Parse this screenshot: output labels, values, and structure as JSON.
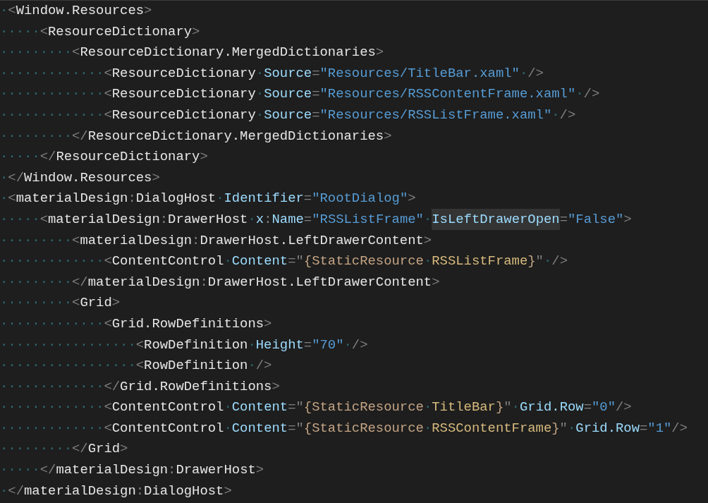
{
  "editor": {
    "lines": [
      {
        "tokens": [
          {
            "kind": "space",
            "text": "·"
          },
          {
            "kind": "punct",
            "text": "<"
          },
          {
            "kind": "tag",
            "text": "Window.Resources"
          },
          {
            "kind": "punct",
            "text": ">"
          }
        ]
      },
      {
        "tokens": [
          {
            "kind": "space",
            "text": "·····"
          },
          {
            "kind": "punct",
            "text": "<"
          },
          {
            "kind": "tag",
            "text": "ResourceDictionary"
          },
          {
            "kind": "punct",
            "text": ">"
          }
        ]
      },
      {
        "tokens": [
          {
            "kind": "space",
            "text": "·········"
          },
          {
            "kind": "punct",
            "text": "<"
          },
          {
            "kind": "tag",
            "text": "ResourceDictionary.MergedDictionaries"
          },
          {
            "kind": "punct",
            "text": ">"
          }
        ]
      },
      {
        "tokens": [
          {
            "kind": "space",
            "text": "·············"
          },
          {
            "kind": "punct",
            "text": "<"
          },
          {
            "kind": "tag",
            "text": "ResourceDictionary"
          },
          {
            "kind": "space",
            "text": "·"
          },
          {
            "kind": "attr",
            "text": "Source"
          },
          {
            "kind": "punct",
            "text": "="
          },
          {
            "kind": "string",
            "text": "\"Resources/TitleBar.xaml\""
          },
          {
            "kind": "space",
            "text": "·"
          },
          {
            "kind": "punct",
            "text": "/>"
          }
        ]
      },
      {
        "tokens": [
          {
            "kind": "space",
            "text": "·············"
          },
          {
            "kind": "punct",
            "text": "<"
          },
          {
            "kind": "tag",
            "text": "ResourceDictionary"
          },
          {
            "kind": "space",
            "text": "·"
          },
          {
            "kind": "attr",
            "text": "Source"
          },
          {
            "kind": "punct",
            "text": "="
          },
          {
            "kind": "string",
            "text": "\"Resources/RSSContentFrame.xaml\""
          },
          {
            "kind": "space",
            "text": "·"
          },
          {
            "kind": "punct",
            "text": "/>"
          }
        ]
      },
      {
        "tokens": [
          {
            "kind": "space",
            "text": "·············"
          },
          {
            "kind": "punct",
            "text": "<"
          },
          {
            "kind": "tag",
            "text": "ResourceDictionary"
          },
          {
            "kind": "space",
            "text": "·"
          },
          {
            "kind": "attr",
            "text": "Source"
          },
          {
            "kind": "punct",
            "text": "="
          },
          {
            "kind": "string",
            "text": "\"Resources/RSSListFrame.xaml\""
          },
          {
            "kind": "space",
            "text": "·"
          },
          {
            "kind": "punct",
            "text": "/>"
          }
        ]
      },
      {
        "tokens": [
          {
            "kind": "space",
            "text": "·········"
          },
          {
            "kind": "punct",
            "text": "</"
          },
          {
            "kind": "tag",
            "text": "ResourceDictionary.MergedDictionaries"
          },
          {
            "kind": "punct",
            "text": ">"
          }
        ]
      },
      {
        "tokens": [
          {
            "kind": "space",
            "text": "·····"
          },
          {
            "kind": "punct",
            "text": "</"
          },
          {
            "kind": "tag",
            "text": "ResourceDictionary"
          },
          {
            "kind": "punct",
            "text": ">"
          }
        ]
      },
      {
        "tokens": [
          {
            "kind": "space",
            "text": "·"
          },
          {
            "kind": "punct",
            "text": "</"
          },
          {
            "kind": "tag",
            "text": "Window.Resources"
          },
          {
            "kind": "punct",
            "text": ">"
          }
        ]
      },
      {
        "tokens": [
          {
            "kind": "space",
            "text": "·"
          },
          {
            "kind": "punct",
            "text": "<"
          },
          {
            "kind": "tag",
            "text": "materialDesign"
          },
          {
            "kind": "punct",
            "text": ":"
          },
          {
            "kind": "tag",
            "text": "DialogHost"
          },
          {
            "kind": "space",
            "text": "·"
          },
          {
            "kind": "attr",
            "text": "Identifier"
          },
          {
            "kind": "punct",
            "text": "="
          },
          {
            "kind": "string",
            "text": "\"RootDialog\""
          },
          {
            "kind": "punct",
            "text": ">"
          }
        ]
      },
      {
        "tokens": [
          {
            "kind": "space",
            "text": "·····"
          },
          {
            "kind": "punct",
            "text": "<"
          },
          {
            "kind": "tag",
            "text": "materialDesign"
          },
          {
            "kind": "punct",
            "text": ":"
          },
          {
            "kind": "tag",
            "text": "DrawerHost"
          },
          {
            "kind": "space",
            "text": "·"
          },
          {
            "kind": "attr",
            "text": "x"
          },
          {
            "kind": "punct",
            "text": ":"
          },
          {
            "kind": "attr",
            "text": "Name"
          },
          {
            "kind": "punct",
            "text": "="
          },
          {
            "kind": "string",
            "text": "\"RSSListFrame\""
          },
          {
            "kind": "space",
            "text": "·"
          },
          {
            "kind": "attr",
            "text": "IsLeftDrawerOpen",
            "highlighted": true
          },
          {
            "kind": "punct",
            "text": "="
          },
          {
            "kind": "string",
            "text": "\"False\""
          },
          {
            "kind": "punct",
            "text": ">"
          }
        ]
      },
      {
        "tokens": [
          {
            "kind": "space",
            "text": "·········"
          },
          {
            "kind": "punct",
            "text": "<"
          },
          {
            "kind": "tag",
            "text": "materialDesign"
          },
          {
            "kind": "punct",
            "text": ":"
          },
          {
            "kind": "tag",
            "text": "DrawerHost.LeftDrawerContent"
          },
          {
            "kind": "punct",
            "text": ">"
          }
        ]
      },
      {
        "tokens": [
          {
            "kind": "space",
            "text": "·············"
          },
          {
            "kind": "punct",
            "text": "<"
          },
          {
            "kind": "tag",
            "text": "ContentControl"
          },
          {
            "kind": "space",
            "text": "·"
          },
          {
            "kind": "attr",
            "text": "Content"
          },
          {
            "kind": "punct",
            "text": "=\""
          },
          {
            "kind": "markup",
            "text": "{StaticResource"
          },
          {
            "kind": "space",
            "text": "·"
          },
          {
            "kind": "resource",
            "text": "RSSListFrame"
          },
          {
            "kind": "markup",
            "text": "}"
          },
          {
            "kind": "punct",
            "text": "\""
          },
          {
            "kind": "space",
            "text": "·"
          },
          {
            "kind": "punct",
            "text": "/>"
          }
        ]
      },
      {
        "tokens": [
          {
            "kind": "space",
            "text": "·········"
          },
          {
            "kind": "punct",
            "text": "</"
          },
          {
            "kind": "tag",
            "text": "materialDesign"
          },
          {
            "kind": "punct",
            "text": ":"
          },
          {
            "kind": "tag",
            "text": "DrawerHost.LeftDrawerContent"
          },
          {
            "kind": "punct",
            "text": ">"
          }
        ]
      },
      {
        "tokens": [
          {
            "kind": "space",
            "text": "·········"
          },
          {
            "kind": "punct",
            "text": "<"
          },
          {
            "kind": "tag",
            "text": "Grid"
          },
          {
            "kind": "punct",
            "text": ">"
          }
        ]
      },
      {
        "tokens": [
          {
            "kind": "space",
            "text": "·············"
          },
          {
            "kind": "punct",
            "text": "<"
          },
          {
            "kind": "tag",
            "text": "Grid.RowDefinitions"
          },
          {
            "kind": "punct",
            "text": ">"
          }
        ]
      },
      {
        "tokens": [
          {
            "kind": "space",
            "text": "·················"
          },
          {
            "kind": "punct",
            "text": "<"
          },
          {
            "kind": "tag",
            "text": "RowDefinition"
          },
          {
            "kind": "space",
            "text": "·"
          },
          {
            "kind": "attr",
            "text": "Height"
          },
          {
            "kind": "punct",
            "text": "="
          },
          {
            "kind": "string",
            "text": "\"70\""
          },
          {
            "kind": "space",
            "text": "·"
          },
          {
            "kind": "punct",
            "text": "/>"
          }
        ]
      },
      {
        "tokens": [
          {
            "kind": "space",
            "text": "·················"
          },
          {
            "kind": "punct",
            "text": "<"
          },
          {
            "kind": "tag",
            "text": "RowDefinition"
          },
          {
            "kind": "space",
            "text": "·"
          },
          {
            "kind": "punct",
            "text": "/>"
          }
        ]
      },
      {
        "tokens": [
          {
            "kind": "space",
            "text": "·············"
          },
          {
            "kind": "punct",
            "text": "</"
          },
          {
            "kind": "tag",
            "text": "Grid.RowDefinitions"
          },
          {
            "kind": "punct",
            "text": ">"
          }
        ]
      },
      {
        "tokens": [
          {
            "kind": "space",
            "text": "·············"
          },
          {
            "kind": "punct",
            "text": "<"
          },
          {
            "kind": "tag",
            "text": "ContentControl"
          },
          {
            "kind": "space",
            "text": "·"
          },
          {
            "kind": "attr",
            "text": "Content"
          },
          {
            "kind": "punct",
            "text": "=\""
          },
          {
            "kind": "markup",
            "text": "{StaticResource"
          },
          {
            "kind": "space",
            "text": "·"
          },
          {
            "kind": "resource",
            "text": "TitleBar"
          },
          {
            "kind": "markup",
            "text": "}"
          },
          {
            "kind": "punct",
            "text": "\""
          },
          {
            "kind": "space",
            "text": "·"
          },
          {
            "kind": "attr",
            "text": "Grid.Row"
          },
          {
            "kind": "punct",
            "text": "="
          },
          {
            "kind": "string",
            "text": "\"0\""
          },
          {
            "kind": "punct",
            "text": "/>"
          }
        ]
      },
      {
        "tokens": [
          {
            "kind": "space",
            "text": "·············"
          },
          {
            "kind": "punct",
            "text": "<"
          },
          {
            "kind": "tag",
            "text": "ContentControl"
          },
          {
            "kind": "space",
            "text": "·"
          },
          {
            "kind": "attr",
            "text": "Content"
          },
          {
            "kind": "punct",
            "text": "=\""
          },
          {
            "kind": "markup",
            "text": "{StaticResource"
          },
          {
            "kind": "space",
            "text": "·"
          },
          {
            "kind": "resource",
            "text": "RSSContentFrame"
          },
          {
            "kind": "markup",
            "text": "}"
          },
          {
            "kind": "punct",
            "text": "\""
          },
          {
            "kind": "space",
            "text": "·"
          },
          {
            "kind": "attr",
            "text": "Grid.Row"
          },
          {
            "kind": "punct",
            "text": "="
          },
          {
            "kind": "string",
            "text": "\"1\""
          },
          {
            "kind": "punct",
            "text": "/>"
          }
        ]
      },
      {
        "tokens": [
          {
            "kind": "space",
            "text": "·········"
          },
          {
            "kind": "punct",
            "text": "</"
          },
          {
            "kind": "tag",
            "text": "Grid"
          },
          {
            "kind": "punct",
            "text": ">"
          }
        ]
      },
      {
        "tokens": [
          {
            "kind": "space",
            "text": "·····"
          },
          {
            "kind": "punct",
            "text": "</"
          },
          {
            "kind": "tag",
            "text": "materialDesign"
          },
          {
            "kind": "punct",
            "text": ":"
          },
          {
            "kind": "tag",
            "text": "DrawerHost"
          },
          {
            "kind": "punct",
            "text": ">"
          }
        ]
      },
      {
        "tokens": [
          {
            "kind": "space",
            "text": "·"
          },
          {
            "kind": "punct",
            "text": "</"
          },
          {
            "kind": "tag",
            "text": "materialDesign"
          },
          {
            "kind": "punct",
            "text": ":"
          },
          {
            "kind": "tag",
            "text": "DialogHost"
          },
          {
            "kind": "punct",
            "text": ">"
          }
        ]
      }
    ]
  }
}
